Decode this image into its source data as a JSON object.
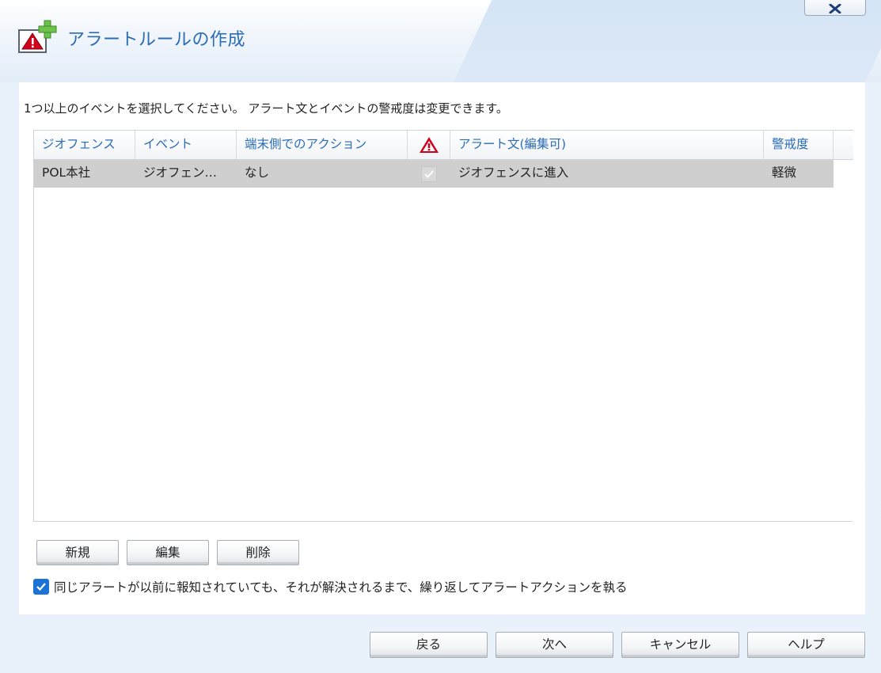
{
  "dialog": {
    "title": "アラートルールの作成",
    "close_label": "x"
  },
  "instruction": "1つ以上のイベントを選択してください。 アラート文とイベントの警戒度は変更できます。",
  "table": {
    "columns": [
      "ジオフェンス",
      "イベント",
      "端末側でのアクション",
      "",
      "アラート文(編集可)",
      "警戒度"
    ],
    "alert_icon": "warning-triangle-icon",
    "rows": [
      {
        "geofence": "POL本社",
        "event": "ジオフェン…",
        "device_action": "なし",
        "alert_checked": true,
        "alert_text": "ジオフェンスに進入",
        "severity": "軽微"
      }
    ]
  },
  "table_buttons": {
    "new": "新規",
    "edit": "編集",
    "delete": "削除"
  },
  "repeat_option": {
    "checked": true,
    "label": "同じアラートが以前に報知されていても、それが解決されるまで、繰り返してアラートアクションを執る"
  },
  "footer": {
    "back": "戻る",
    "next": "次へ",
    "cancel": "キャンセル",
    "help": "ヘルプ"
  },
  "colors": {
    "accent": "#2b6cb6",
    "checkbox": "#1c72d6",
    "selected_row": "#cfcfcf",
    "warning": "#d0021b"
  }
}
